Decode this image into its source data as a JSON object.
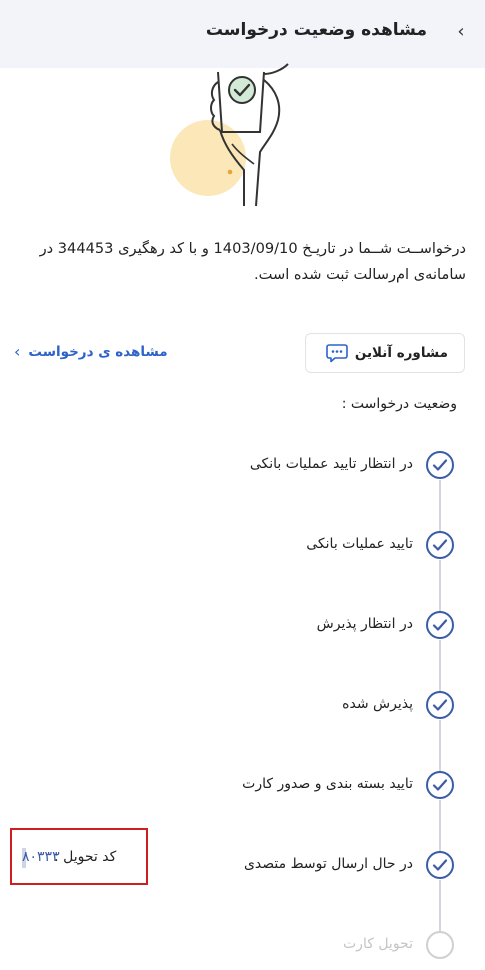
{
  "header": {
    "title": "مشاهده وضعیت درخواست",
    "back_glyph": "‹"
  },
  "description": "درخواســت شــما در تاریـخ 1403/09/10 و با کد رهگیری 344453 در سامانه‌ی ام‌رسالت ثبت شده است.",
  "actions": {
    "consult_label": "مشاوره آنلاین",
    "view_request_label": "مشاهده ی درخواست",
    "view_chevron": "‹"
  },
  "status_heading": "وضعیت درخواست :",
  "steps": [
    {
      "label": "در انتظار تایید عملیات بانکی",
      "state": "done"
    },
    {
      "label": "تایید عملیات بانکی",
      "state": "done"
    },
    {
      "label": "در انتظار پذیرش",
      "state": "done"
    },
    {
      "label": "پذیرش شده",
      "state": "done"
    },
    {
      "label": "تایید بسته بندی و صدور کارت",
      "state": "done"
    },
    {
      "label": "در حال ارسال توسط متصدی",
      "state": "done"
    },
    {
      "label": "تحویل کارت",
      "state": "pending"
    }
  ],
  "delivery_code": {
    "label": "کد تحویل :",
    "value": "۸۰۳۳۳"
  },
  "colors": {
    "accent": "#2d62c9",
    "step_done": "#3a5ba8",
    "step_pending": "#cfcfcf",
    "highlight_border": "#cc1f1f"
  },
  "icons": {
    "back": "chevron-right-icon",
    "consult": "chat-bubble-icon",
    "view_link": "chevron-left-icon",
    "step_done": "check-circle-icon",
    "step_pending": "empty-circle-icon",
    "illustration": "hand-holding-phone-illustration"
  }
}
